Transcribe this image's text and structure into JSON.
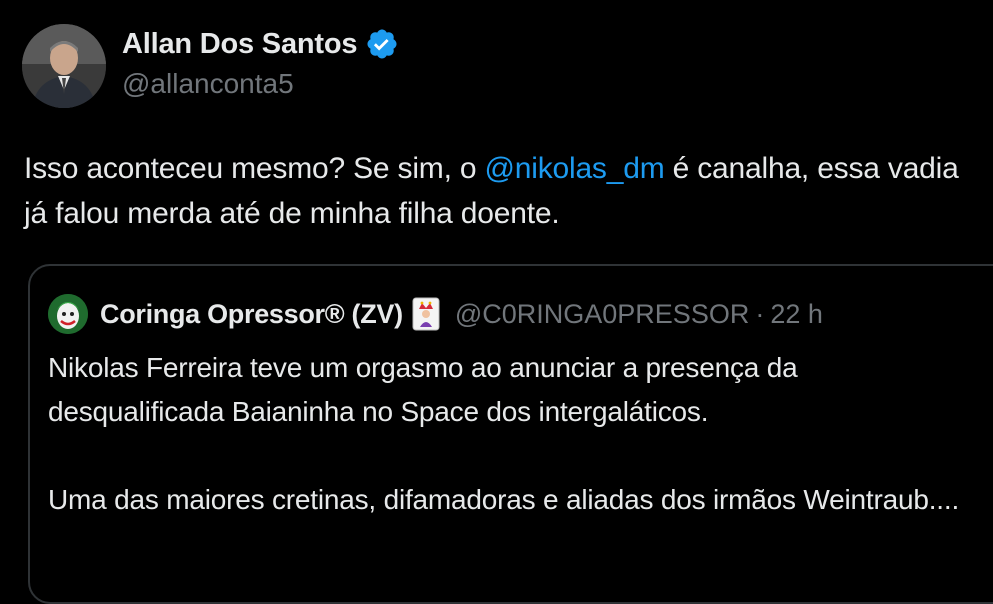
{
  "author": {
    "name": "Allan Dos Santos",
    "handle": "@allanconta5",
    "verified": true
  },
  "tweet": {
    "text_before": "Isso aconteceu mesmo? Se sim, o ",
    "mention": "@nikolas_dm",
    "text_after": " é canalha, essa vadia já falou merda até de minha filha doente."
  },
  "quote": {
    "name": "Coringa Opressor® (ZV)",
    "name_emoji": "joker-card-icon",
    "handle": "@C0RINGA0PRESSOR",
    "separator": "·",
    "time": "22 h",
    "paragraph_1": "Nikolas Ferreira teve um orgasmo ao anunciar a presença da desqualificada Baianinha no Space dos intergaláticos.",
    "paragraph_2": "Uma das maiores cretinas, difamadoras e aliadas dos irmãos Weintraub...."
  },
  "colors": {
    "background": "#000000",
    "text_primary": "#e7e9ea",
    "text_secondary": "#71767b",
    "link": "#1d9bf0",
    "verified_badge": "#1d9bf0",
    "border": "#2f3336"
  }
}
